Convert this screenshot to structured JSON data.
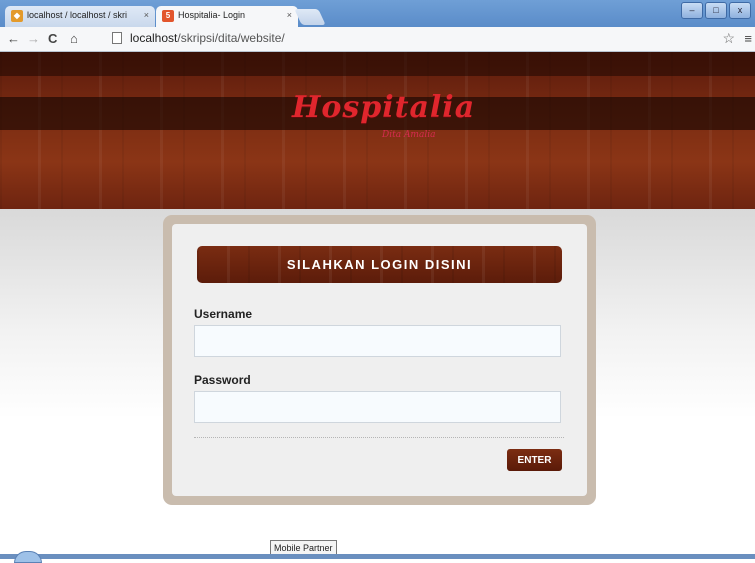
{
  "browser": {
    "tabs": [
      {
        "title": "localhost / localhost / skri",
        "active": false,
        "close": "×"
      },
      {
        "title": "Hospitalia- Login",
        "active": true,
        "close": "×"
      }
    ],
    "url_host": "localhost",
    "url_path": "/skripsi/dita/website/",
    "window_buttons": {
      "minimize": "–",
      "maximize": "□",
      "close": "x"
    }
  },
  "banner": {
    "logo": "Hospitalia",
    "logo_subtitle": "Dita Amalia"
  },
  "login": {
    "header": "SILAHKAN LOGIN DISINI",
    "username_label": "Username",
    "username_value": "",
    "password_label": "Password",
    "password_value": "",
    "submit_label": "ENTER"
  },
  "tooltip": "Mobile Partner",
  "colors": {
    "brand_red": "#e0262d",
    "wood_brown": "#7a2c12",
    "panel_border": "#c9bcae"
  }
}
